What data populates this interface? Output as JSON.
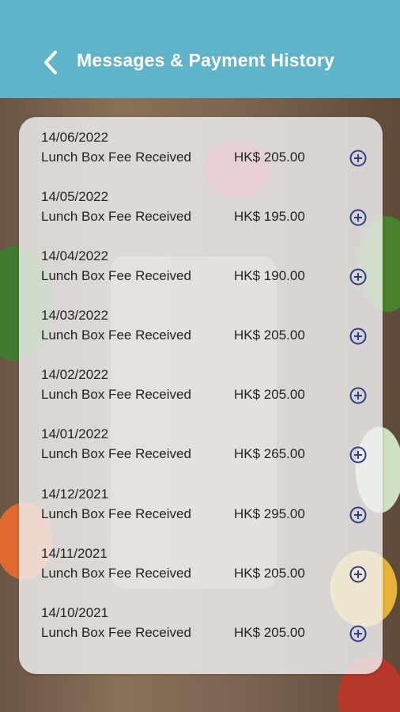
{
  "header": {
    "title": "Messages & Payment History",
    "back_icon": "chevron-left-icon",
    "background_color": "#5fb4c9"
  },
  "payments": [
    {
      "date": "14/06/2022",
      "description": "Lunch Box Fee Received",
      "amount": "HK$ 205.00"
    },
    {
      "date": "14/05/2022",
      "description": "Lunch Box Fee Received",
      "amount": "HK$ 195.00"
    },
    {
      "date": "14/04/2022",
      "description": "Lunch Box Fee Received",
      "amount": "HK$ 190.00"
    },
    {
      "date": "14/03/2022",
      "description": "Lunch Box Fee Received",
      "amount": "HK$ 205.00"
    },
    {
      "date": "14/02/2022",
      "description": "Lunch Box Fee Received",
      "amount": "HK$ 205.00"
    },
    {
      "date": "14/01/2022",
      "description": "Lunch Box Fee Received",
      "amount": "HK$ 265.00"
    },
    {
      "date": "14/12/2021",
      "description": "Lunch Box Fee Received",
      "amount": "HK$ 295.00"
    },
    {
      "date": "14/11/2021",
      "description": "Lunch Box Fee Received",
      "amount": "HK$ 205.00"
    },
    {
      "date": "14/10/2021",
      "description": "Lunch Box Fee Received",
      "amount": "HK$ 205.00"
    }
  ],
  "expand_icon": "plus-circle-icon",
  "expand_icon_color": "#2c3f8f"
}
